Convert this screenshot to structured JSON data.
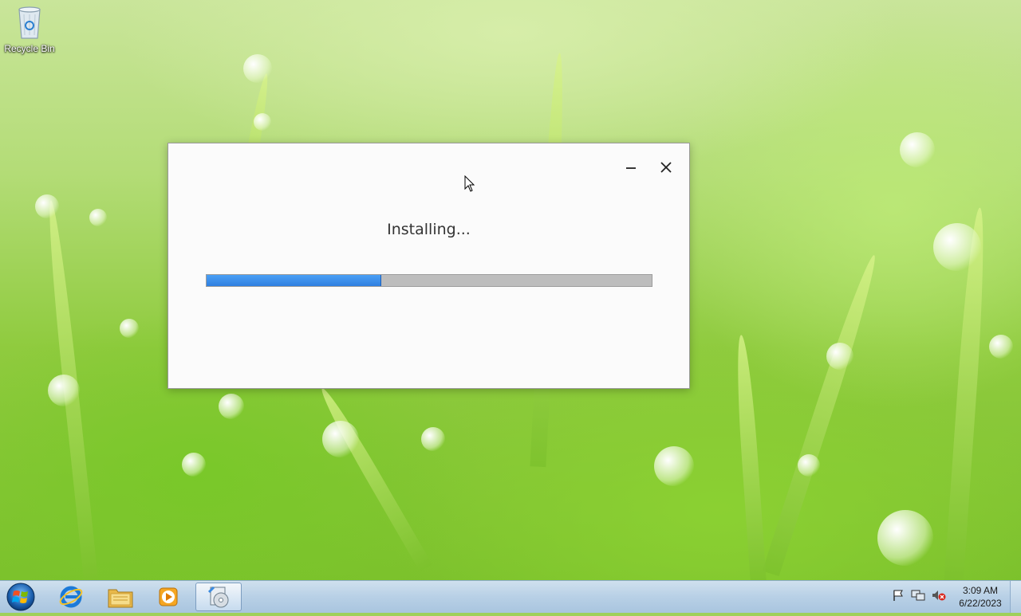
{
  "desktop": {
    "icons": [
      {
        "label": "Recycle Bin",
        "icon": "recycle-bin-icon"
      }
    ]
  },
  "installer": {
    "status_text": "Installing...",
    "progress_fraction": 0.39,
    "buttons": {
      "minimize": "minimize-icon",
      "close": "close-icon"
    },
    "colors": {
      "progress_fill": "#3a8ff0",
      "progress_track": "#bdbdbd",
      "background": "#fbfbfb"
    }
  },
  "taskbar": {
    "start_icon": "windows-start-icon",
    "pinned": [
      {
        "name": "internet-explorer",
        "icon": "internet-explorer-icon"
      },
      {
        "name": "file-explorer",
        "icon": "folder-icon"
      },
      {
        "name": "media-player",
        "icon": "media-player-icon"
      },
      {
        "name": "installer-app",
        "icon": "installer-app-icon",
        "active": true
      }
    ],
    "tray": [
      {
        "name": "action-center",
        "icon": "flag-icon"
      },
      {
        "name": "network",
        "icon": "network-icon"
      },
      {
        "name": "volume",
        "icon": "volume-muted-icon"
      }
    ],
    "clock": {
      "time": "3:09 AM",
      "date": "6/22/2023"
    }
  }
}
